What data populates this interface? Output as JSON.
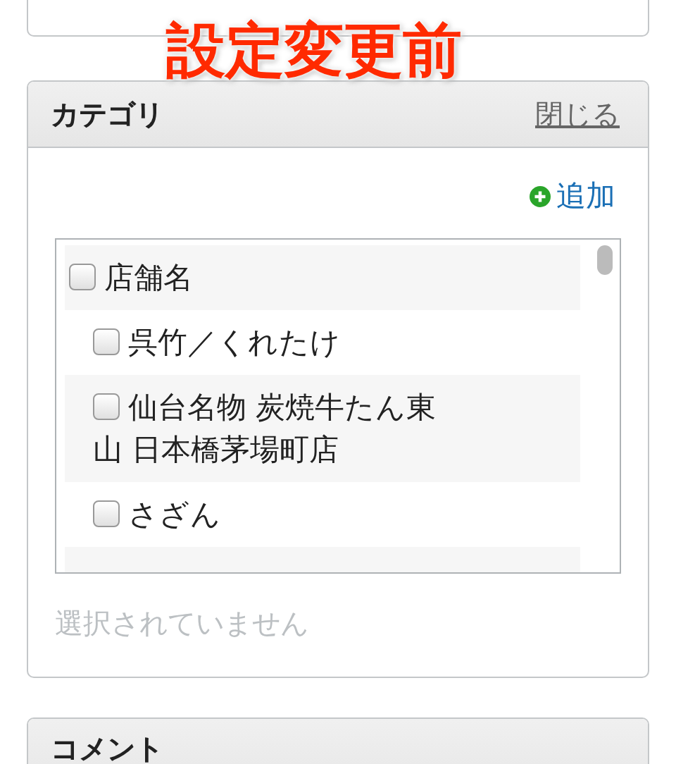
{
  "annotation": "設定変更前",
  "category": {
    "title": "カテゴリ",
    "close_link": "閉じる",
    "add_link": "追加",
    "items": [
      {
        "label": "店舗名",
        "checked": false,
        "children": [
          {
            "label": "呉竹／くれたけ",
            "checked": false
          },
          {
            "label": "仙台名物 炭焼牛たん東山 日本橋茅場町店",
            "checked": false
          },
          {
            "label": "さざん",
            "checked": false
          }
        ]
      }
    ],
    "selection_status": "選択されていません"
  },
  "comment": {
    "title": "コメント"
  }
}
